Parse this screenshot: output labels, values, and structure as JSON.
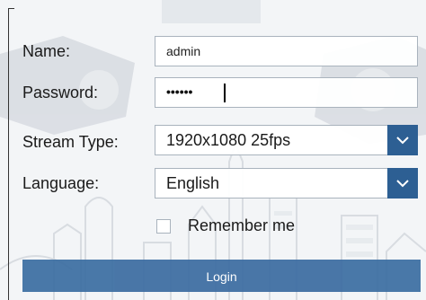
{
  "form": {
    "name_label": "Name:",
    "name_value": "admin",
    "password_label": "Password:",
    "password_masked": "••••••",
    "stream_type_label": "Stream Type:",
    "stream_type_value": "1920x1080 25fps",
    "language_label": "Language:",
    "language_value": "English",
    "remember_label": "Remember me",
    "remember_checked": false,
    "login_label": "Login"
  },
  "colors": {
    "accent": "#2d5f93",
    "login_button": "#3b6ca1",
    "field_border": "#a9b3bd"
  },
  "icons": {
    "dropdown": "chevron-down-icon"
  }
}
